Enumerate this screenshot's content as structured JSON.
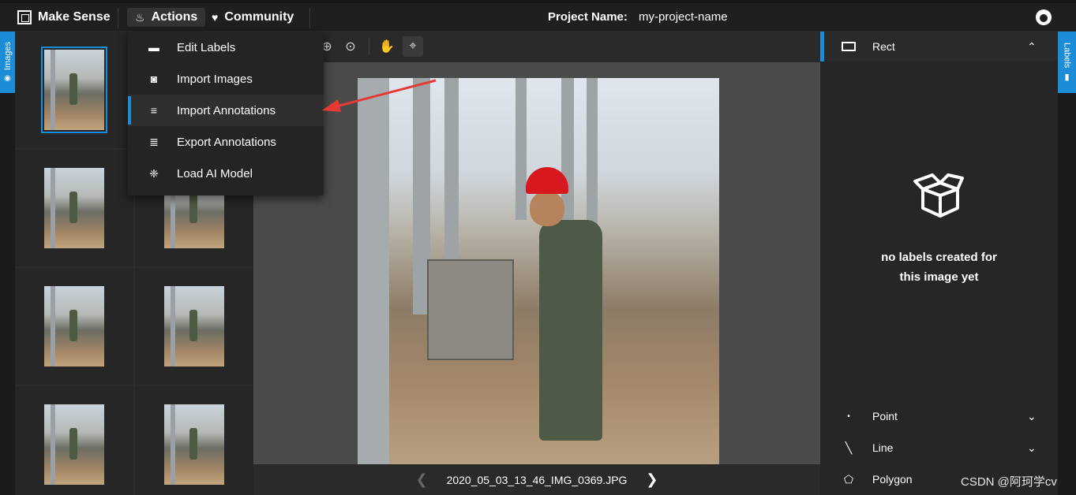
{
  "app": {
    "brand": "Make Sense"
  },
  "nav": {
    "actions": "Actions",
    "community": "Community"
  },
  "project": {
    "label": "Project Name:",
    "name": "my-project-name"
  },
  "left_tab": {
    "label": "Images"
  },
  "right_tab": {
    "label": "Labels"
  },
  "menu": {
    "items": [
      {
        "label": "Edit Labels",
        "icon": "label-icon"
      },
      {
        "label": "Import Images",
        "icon": "camera-icon"
      },
      {
        "label": "Import Annotations",
        "icon": "import-list-icon",
        "active": true
      },
      {
        "label": "Export Annotations",
        "icon": "export-list-icon"
      },
      {
        "label": "Load AI Model",
        "icon": "ai-model-icon"
      }
    ]
  },
  "canvas": {
    "filename": "2020_05_03_13_46_IMG_0369.JPG"
  },
  "right_panel": {
    "rect_label": "Rect",
    "empty_line1": "no labels created for",
    "empty_line2": "this image yet",
    "point_label": "Point",
    "line_label": "Line",
    "polygon_label": "Polygon"
  },
  "watermark": "CSDN @阿珂学cv",
  "colors": {
    "accent": "#1a8cd8",
    "annotation_arrow": "#e53935"
  }
}
